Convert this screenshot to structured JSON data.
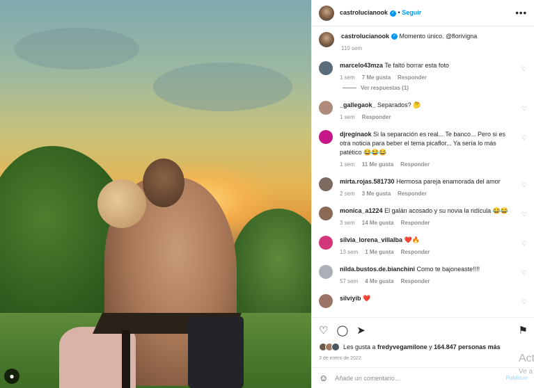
{
  "post": {
    "author": "castrolucianook",
    "follow_label": "Seguir",
    "more_label": "•••",
    "caption": "Momento único. @florivigna",
    "caption_time": "110 sem"
  },
  "comments": [
    {
      "user": "marcelo43mza",
      "text": "Te faltó borrar esta foto",
      "time": "1 sem",
      "likes": "7 Me gusta",
      "reply": "Responder",
      "avatar_color": "#5a6b7a"
    },
    {
      "user": "_gallegaok_",
      "text": "Separados? 🤔",
      "time": "1 sem",
      "likes": "",
      "reply": "Responder",
      "avatar_color": "#b08a7a"
    },
    {
      "user": "djreginaok",
      "text": "Si la separación es real... Te banco... Pero si es otra noticia para beber el tema picaflor... Ya sería lo más patético 😂😂😂",
      "time": "1 sem",
      "likes": "11 Me gusta",
      "reply": "Responder",
      "avatar_color": "#c5178a"
    },
    {
      "user": "mirta.rojas.581730",
      "text": "Hermosa pareja enamorada del amor",
      "time": "2 sem",
      "likes": "3 Me gusta",
      "reply": "Responder",
      "avatar_color": "#7d6a60"
    },
    {
      "user": "monica_a1224",
      "text": "El galán acosado y su novia la ridícula 😂😂",
      "time": "3 sem",
      "likes": "14 Me gusta",
      "reply": "Responder",
      "avatar_color": "#8a6a55"
    },
    {
      "user": "silvia_lorena_villalba",
      "text": "❤️🔥",
      "time": "13 sem",
      "likes": "1 Me gusta",
      "reply": "Responder",
      "avatar_color": "#d4367a"
    },
    {
      "user": "nilda.bustos.de.bianchini",
      "text": "Como te bajoneaste!!!!",
      "time": "57 sem",
      "likes": "4 Me gusta",
      "reply": "Responder",
      "avatar_color": "#aab0b5"
    },
    {
      "user": "silviyib",
      "text": "❤️",
      "time": "",
      "likes": "",
      "reply": "",
      "avatar_color": "#9a7565"
    }
  ],
  "replies_label": "Ver respuestas (1)",
  "actions": {
    "like_icon": "heart-outline",
    "comment_icon": "comment-bubble",
    "share_icon": "paper-plane",
    "save_icon": "bookmark"
  },
  "likes": {
    "prefix": "Les gusta a ",
    "user": "fredyvegamilone",
    "middle": " y ",
    "count": "164.847 personas más"
  },
  "date": "3 de enero de 2022",
  "add_comment": {
    "placeholder": "Añade un comentario...",
    "publish": "Publicar"
  },
  "watermark": {
    "line1": "Act",
    "line2": "Ve a"
  },
  "colors": {
    "accent": "#0095f6",
    "muted": "#8e8e8e",
    "text": "#262626"
  }
}
